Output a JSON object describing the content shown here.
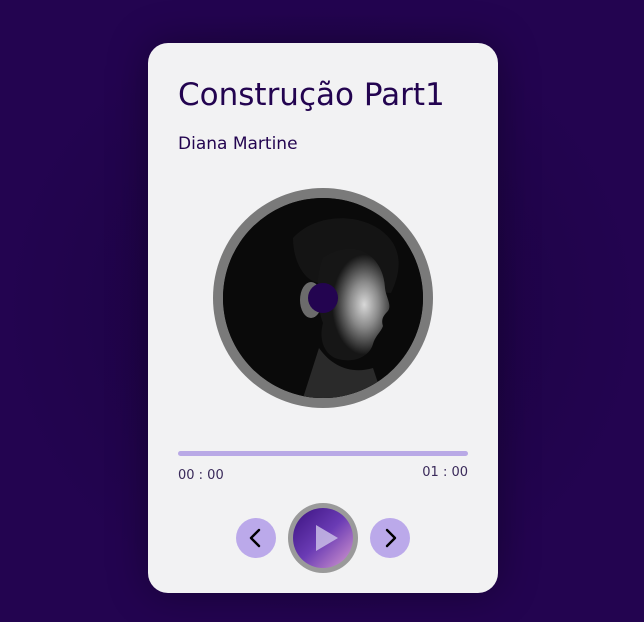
{
  "player": {
    "title": "Construção Part1",
    "artist": "Diana Martine",
    "time_current": "00 : 00",
    "time_total": "01 : 00",
    "progress": 0,
    "colors": {
      "background": "#230450",
      "card": "#f2f2f3",
      "accent": "#b9a9e6",
      "text": "#230450"
    }
  },
  "controls": {
    "prev_icon": "chevron-left-icon",
    "play_icon": "play-icon",
    "next_icon": "chevron-right-icon"
  }
}
